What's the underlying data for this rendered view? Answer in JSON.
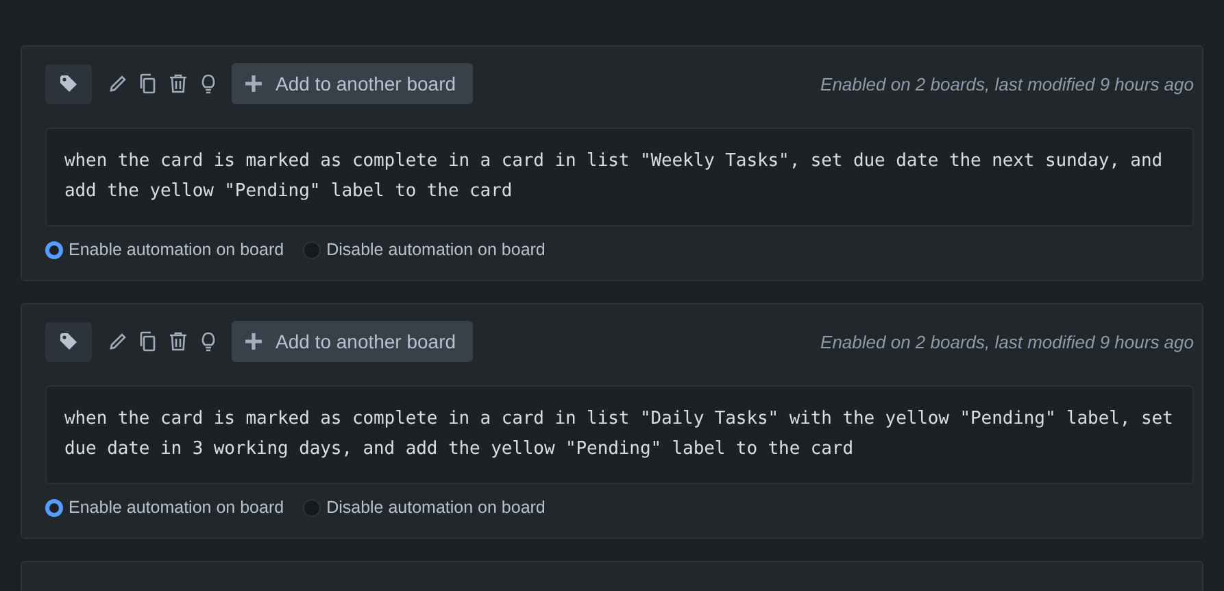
{
  "rules": [
    {
      "add_button": "Add to another board",
      "status": "Enabled on 2 boards, last modified 9 hours ago",
      "description": "when the card is marked as complete in a card in list \"Weekly Tasks\", set due date the next sunday, and add the yellow \"Pending\" label to the card",
      "options": [
        {
          "label": "Enable automation on board",
          "selected": true
        },
        {
          "label": "Disable automation on board",
          "selected": false
        }
      ]
    },
    {
      "add_button": "Add to another board",
      "status": "Enabled on 2 boards, last modified 9 hours ago",
      "description": "when the card is marked as complete in a card in list \"Daily Tasks\" with the yellow \"Pending\" label, set due date in 3 working days, and add the yellow \"Pending\" label to the card",
      "options": [
        {
          "label": "Enable automation on board",
          "selected": true
        },
        {
          "label": "Disable automation on board",
          "selected": false
        }
      ]
    }
  ]
}
